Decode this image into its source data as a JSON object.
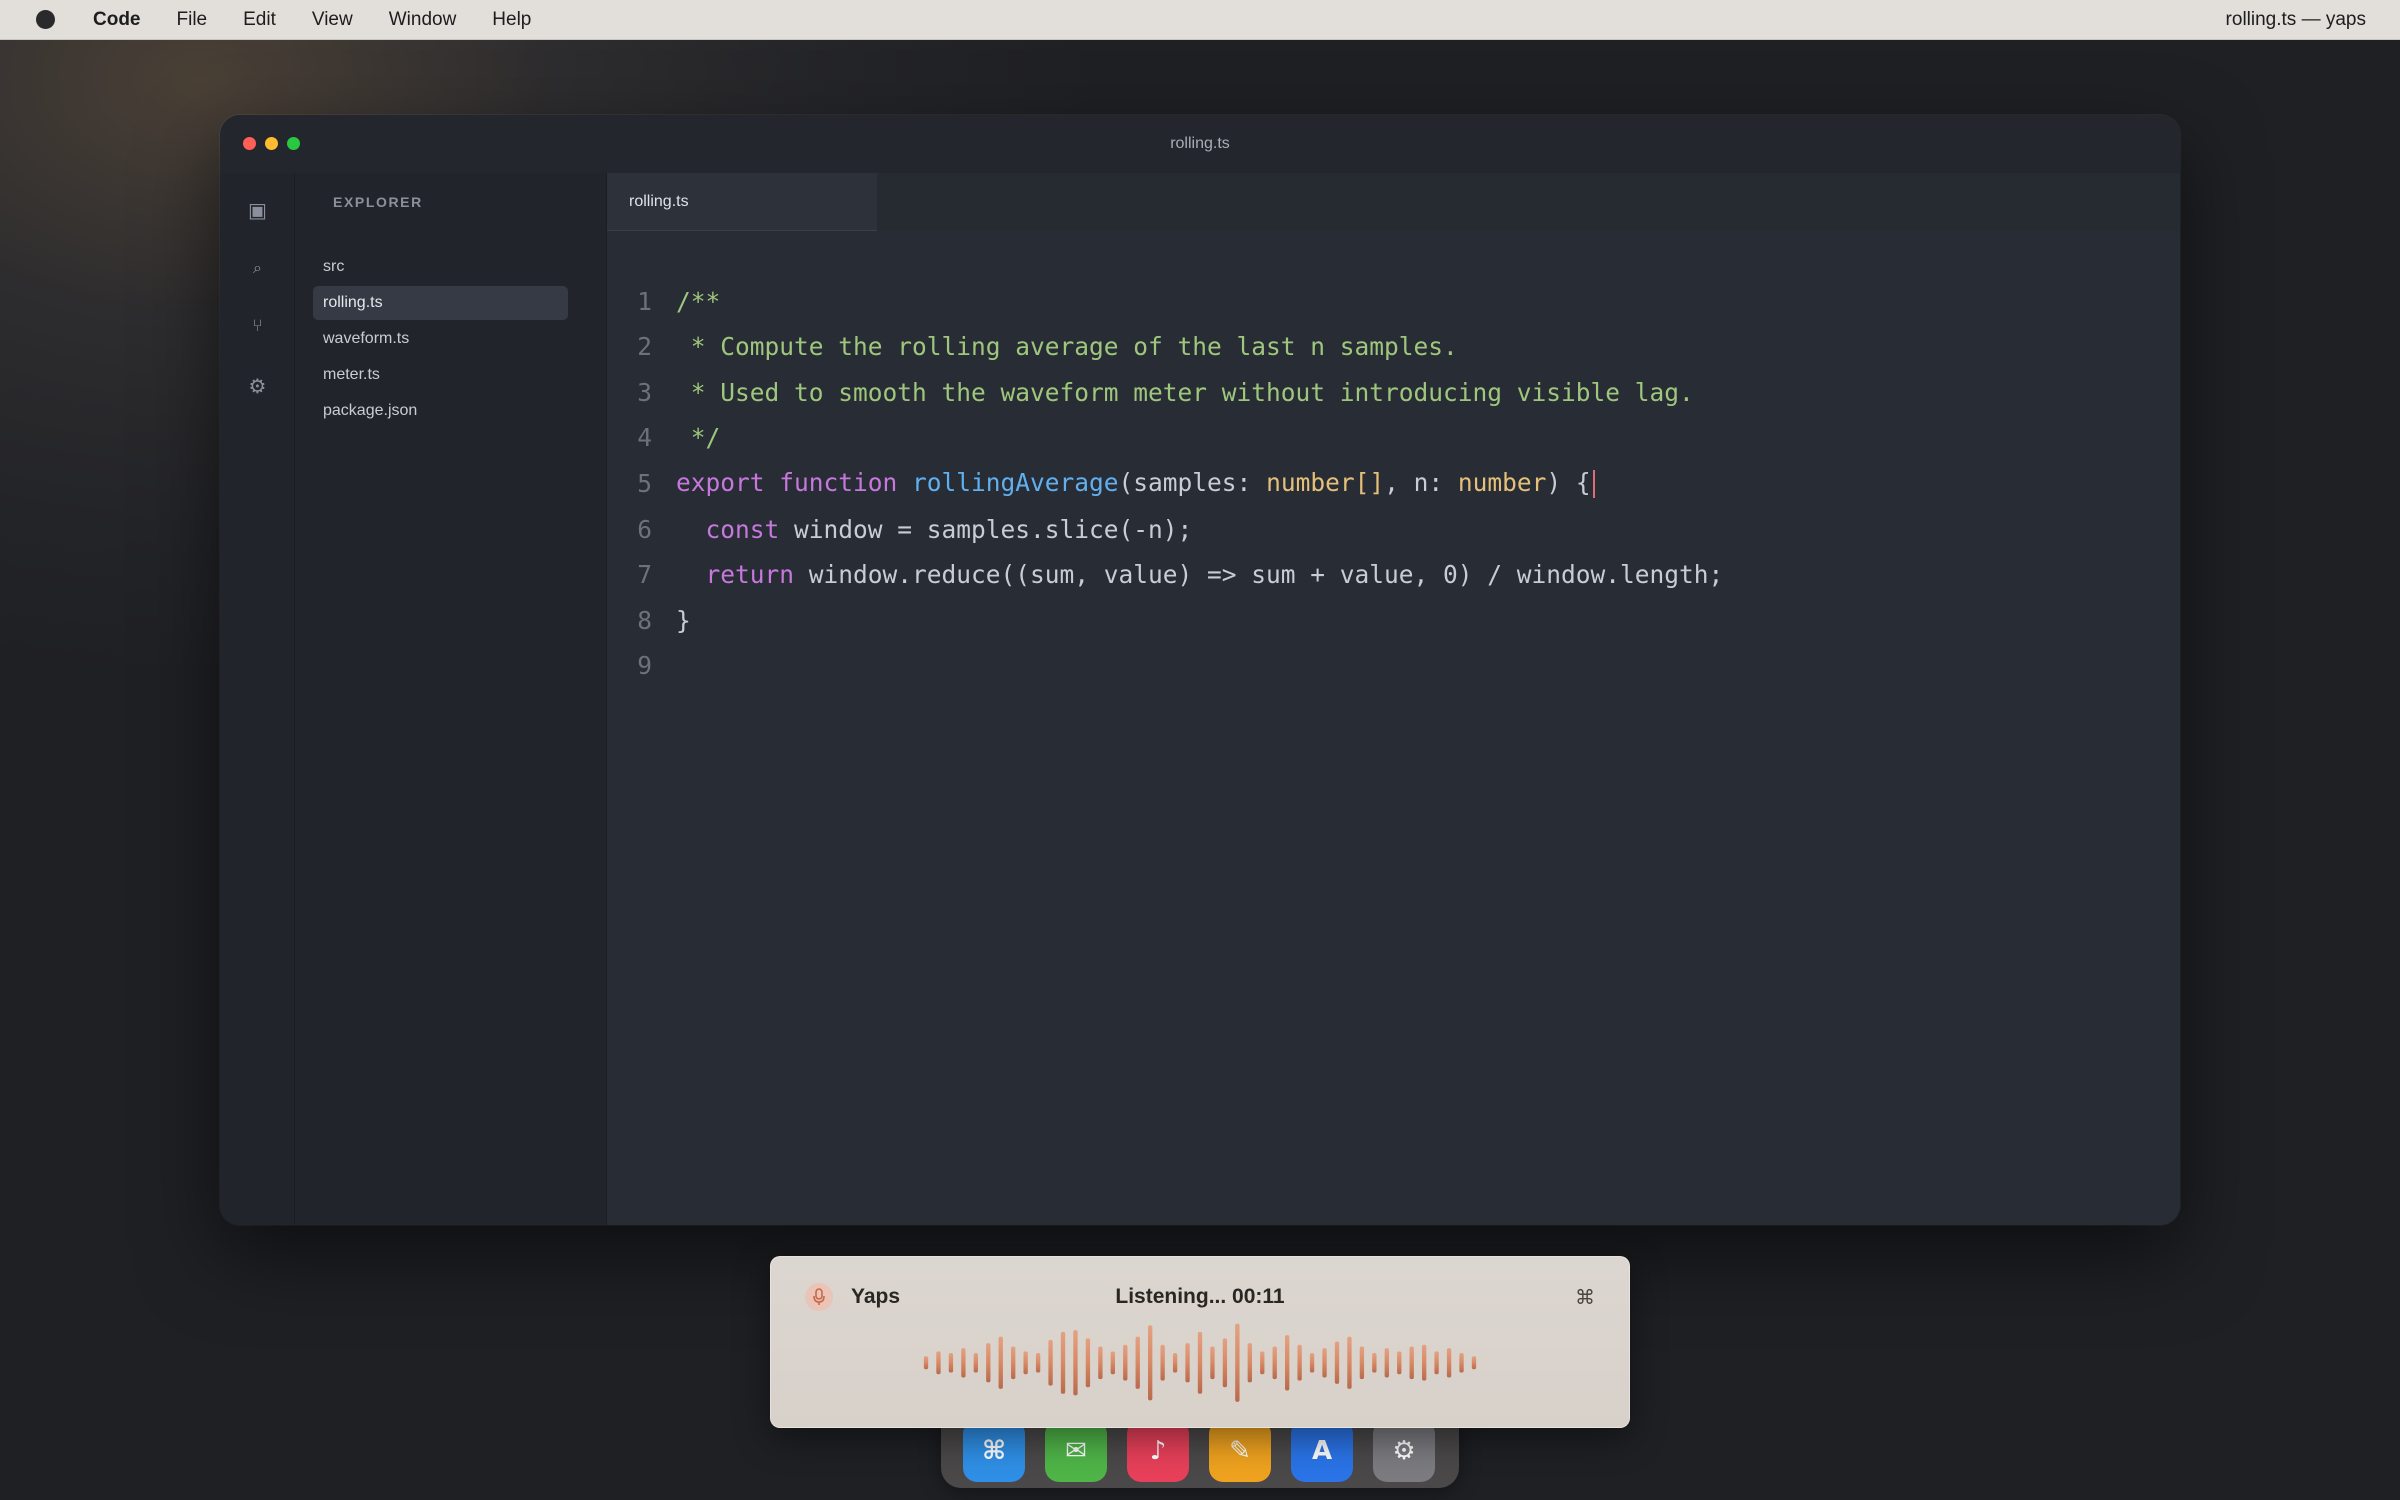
{
  "menubar": {
    "app_name": "Code",
    "items": [
      "File",
      "Edit",
      "View",
      "Window",
      "Help"
    ],
    "right_title": "rolling.ts — yaps"
  },
  "window": {
    "title": "rolling.ts"
  },
  "activity_icons": [
    "files-icon",
    "search-icon",
    "source-control-icon",
    "gear-icon"
  ],
  "sidebar": {
    "title": "EXPLORER",
    "files": [
      {
        "name": "src",
        "active": false
      },
      {
        "name": "rolling.ts",
        "active": true
      },
      {
        "name": "waveform.ts",
        "active": false
      },
      {
        "name": "meter.ts",
        "active": false
      },
      {
        "name": "package.json",
        "active": false
      }
    ]
  },
  "editor": {
    "tab": "rolling.ts",
    "lines": [
      [
        {
          "t": "/**",
          "c": "com"
        }
      ],
      [
        {
          "t": " * Compute the rolling average of the last n samples.",
          "c": "com"
        }
      ],
      [
        {
          "t": " * Used to smooth the waveform meter without introducing visible lag.",
          "c": "com"
        }
      ],
      [
        {
          "t": " */",
          "c": "com"
        }
      ],
      [
        {
          "t": "export ",
          "c": "kw"
        },
        {
          "t": "function ",
          "c": "kw"
        },
        {
          "t": "rollingAverage",
          "c": "fn"
        },
        {
          "t": "(samples: ",
          "c": "pl"
        },
        {
          "t": "number[]",
          "c": "ty"
        },
        {
          "t": ", n: ",
          "c": "pl"
        },
        {
          "t": "number",
          "c": "ty"
        },
        {
          "t": ") {",
          "c": "pl"
        }
      ],
      [
        {
          "t": "  ",
          "c": "pl"
        },
        {
          "t": "const ",
          "c": "kw"
        },
        {
          "t": "window = samples.slice(-n);",
          "c": "pl"
        }
      ],
      [
        {
          "t": "  ",
          "c": "pl"
        },
        {
          "t": "return ",
          "c": "kw"
        },
        {
          "t": "window.reduce((sum, value) => sum + value, 0) / window.length;",
          "c": "pl"
        }
      ],
      [
        {
          "t": "}",
          "c": "pl"
        }
      ],
      []
    ],
    "cursor_line": 5
  },
  "yaps": {
    "app_name": "Yaps",
    "status": "Listening... 00:11",
    "shortcut": "⌘",
    "levels": [
      0.2,
      0.35,
      0.3,
      0.45,
      0.3,
      0.6,
      0.8,
      0.5,
      0.35,
      0.3,
      0.7,
      0.95,
      1.0,
      0.75,
      0.5,
      0.35,
      0.55,
      0.8,
      1.15,
      0.55,
      0.3,
      0.6,
      0.95,
      0.5,
      0.75,
      1.2,
      0.6,
      0.35,
      0.5,
      0.85,
      0.55,
      0.3,
      0.45,
      0.65,
      0.8,
      0.5,
      0.3,
      0.45,
      0.35,
      0.5,
      0.55,
      0.35,
      0.45,
      0.3,
      0.2
    ],
    "accent": "#d88a66"
  },
  "dock": [
    {
      "icon": "command-icon",
      "glyph": "⌘",
      "color": "#2f8fe6"
    },
    {
      "icon": "mail-icon",
      "glyph": "✉",
      "color": "#4fb548"
    },
    {
      "icon": "music-icon",
      "glyph": "♪",
      "color": "#e8405a"
    },
    {
      "icon": "pencil-icon",
      "glyph": "✎",
      "color": "#efa21f"
    },
    {
      "icon": "app-store-icon",
      "glyph": "A",
      "color": "#2a74e8"
    },
    {
      "icon": "settings-icon",
      "glyph": "⚙",
      "color": "#7b7b80"
    }
  ]
}
